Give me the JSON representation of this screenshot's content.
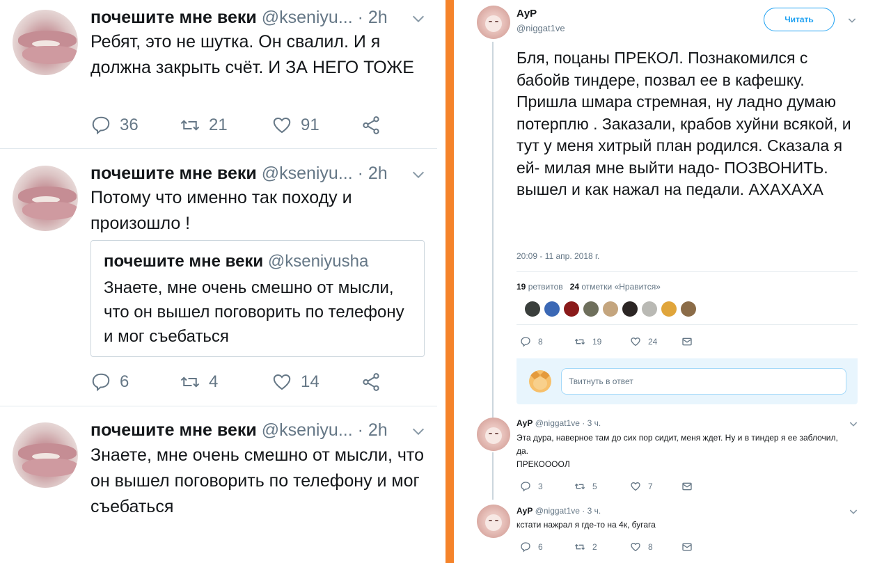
{
  "left": {
    "tweets": [
      {
        "name": "почешите мне веки",
        "handle": "@kseniyu...",
        "time": "· 2h",
        "text": "Ребят, это не шутка. Он свалил. И я должна закрыть счёт.  И ЗА НЕГО ТОЖЕ",
        "replies": "36",
        "retweets": "21",
        "likes": "91"
      },
      {
        "name": "почешите мне веки",
        "handle": "@kseniyu...",
        "time": "· 2h",
        "text": "Потому что именно так походу и произошло !",
        "quote": {
          "name": "почешите мне веки",
          "handle": "@kseniyusha",
          "text": "Знаете, мне очень смешно от мысли, что он вышел поговорить по телефону и мог съебаться"
        },
        "replies": "6",
        "retweets": "4",
        "likes": "14"
      },
      {
        "name": "почешите мне веки",
        "handle": "@kseniyu...",
        "time": "· 2h",
        "text": "Знаете, мне очень смешно от мысли, что он вышел поговорить по телефону и мог съебаться"
      }
    ]
  },
  "right": {
    "author": {
      "name": "АуР",
      "handle": "@niggat1ve"
    },
    "follow_label": "Читать",
    "main_text": "Бля, поцаны ПРЕКОЛ. Познакомился  с бабойв тиндере, позвал ее в кафешку. Пришла шмара стремная, ну ладно думаю потерплю . Заказали, крабов хуйни  всякой, и тут у меня  хитрый план родился. Сказала я ей- милая мне выйти надо- ПОЗВОНИТЬ. вышел и как нажал на педали. АХАХАХА",
    "timestamp": "20:09 - 11 апр. 2018 г.",
    "retweet_count": "19",
    "retweet_label": "ретвитов",
    "like_count": "24",
    "like_label": "отметки «Нравится»",
    "actions": {
      "replies": "8",
      "retweets": "19",
      "likes": "24"
    },
    "reply_placeholder": "Твитнуть в ответ",
    "replies": [
      {
        "name": "АуР",
        "handle": "@niggat1ve",
        "time": "· 3 ч.",
        "text": "Эта дура, наверное там до сих пор сидит, меня ждет. Ну и в тиндер я ее заблочил, да.",
        "text2": "ПРЕКОООOЛ",
        "replies": "3",
        "retweets": "5",
        "likes": "7"
      },
      {
        "name": "АуР",
        "handle": "@niggat1ve",
        "time": "· 3 ч.",
        "text": "кстати нажрал я где-то на 4к, бугага",
        "replies": "6",
        "retweets": "2",
        "likes": "8"
      }
    ]
  },
  "colors": {
    "divider_orange": "#f5832a",
    "twitter_blue": "#1da1f2",
    "gray_text": "#657786"
  }
}
